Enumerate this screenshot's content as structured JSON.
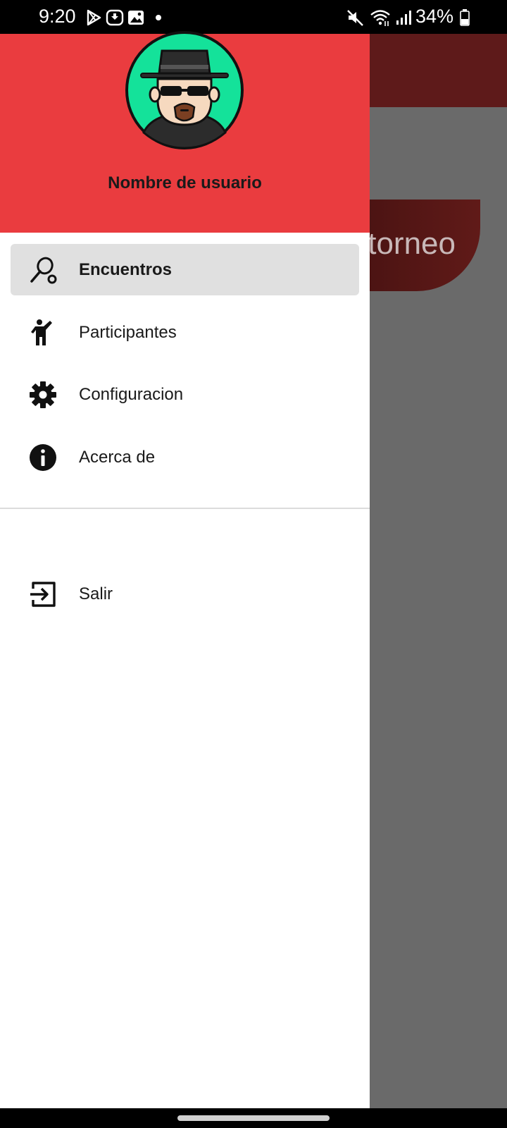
{
  "status_bar": {
    "time": "9:20",
    "battery_percent": "34%",
    "left_icons": [
      "play-store-icon",
      "downloader-icon",
      "gallery-icon",
      "notification-dot-icon"
    ],
    "right_icons": [
      "mute-icon",
      "wifi-icon",
      "signal-icon",
      "battery-icon"
    ]
  },
  "background_app": {
    "pill_text": "torneo",
    "toolbar_color": "#5e1a1a"
  },
  "drawer": {
    "header_color": "#ea3c3f",
    "user_name": "Nombre de usuario",
    "avatar_icon": "user-avatar-icon",
    "items": [
      {
        "label": "Encuentros",
        "icon": "racket-icon",
        "selected": true
      },
      {
        "label": "Participantes",
        "icon": "person-waving-icon",
        "selected": false
      },
      {
        "label": "Configuracion",
        "icon": "gear-icon",
        "selected": false
      },
      {
        "label": "Acerca de",
        "icon": "info-icon",
        "selected": false
      }
    ],
    "footer_items": [
      {
        "label": "Salir",
        "icon": "logout-icon"
      }
    ]
  }
}
